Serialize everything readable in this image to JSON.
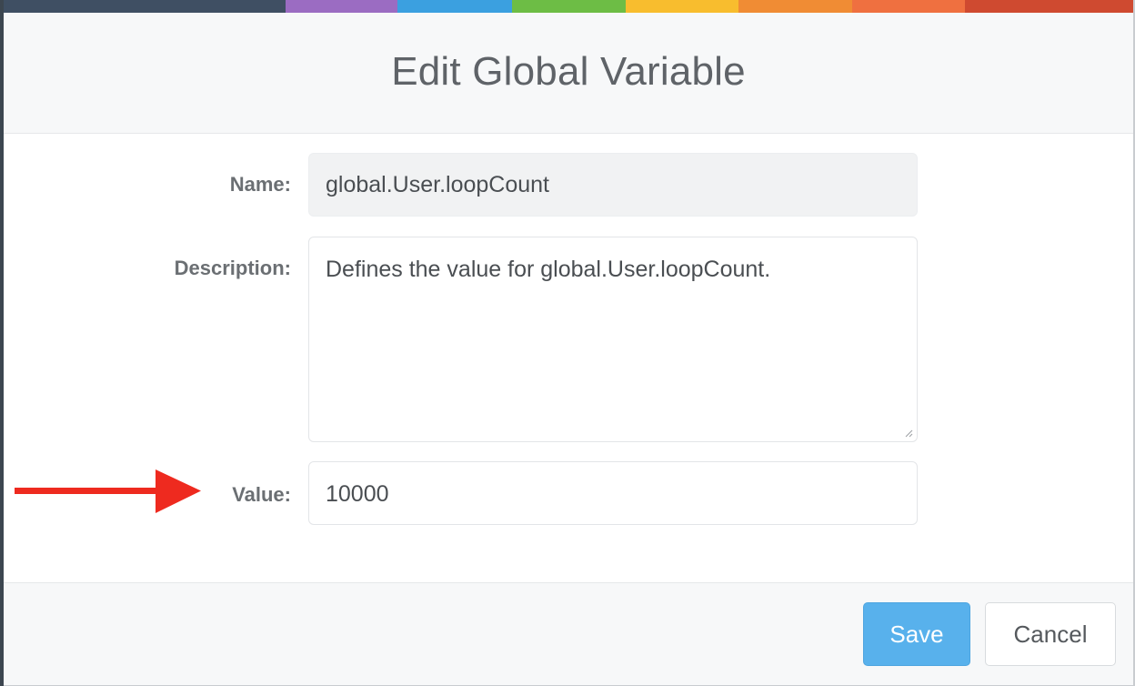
{
  "color_bar": [
    "#3f4f63",
    "#9b6cc2",
    "#3ba0e0",
    "#6dbd45",
    "#f8bd2e",
    "#f08c34",
    "#ef7040",
    "#cf4a30"
  ],
  "dialog": {
    "title": "Edit Global Variable",
    "fields": {
      "name": {
        "label": "Name:",
        "value": "global.User.loopCount"
      },
      "description": {
        "label": "Description:",
        "value": "Defines the value for global.User.loopCount."
      },
      "value": {
        "label": "Value:",
        "value": "10000"
      }
    },
    "buttons": {
      "save": "Save",
      "cancel": "Cancel"
    }
  },
  "annotation": {
    "icon": "red-arrow-icon",
    "color": "#ee2a1f"
  },
  "colors": {
    "primary_button": "#58b1ec",
    "label_text": "#6b6f73",
    "title_text": "#5f6368"
  }
}
